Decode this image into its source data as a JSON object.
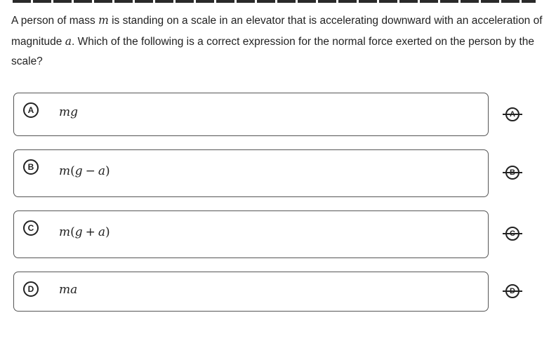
{
  "question": {
    "part1": "A person of mass ",
    "var1": "m",
    "part2": " is standing on a scale in an elevator that is accelerating downward with an acceleration of magnitude ",
    "var2": "a",
    "part3": ". Which of the following is a correct expression for the normal force exerted on the person by the scale?"
  },
  "choices": [
    {
      "letter": "A",
      "expression": "mg"
    },
    {
      "letter": "B",
      "expression": "m(g − a)"
    },
    {
      "letter": "C",
      "expression": "m(g + a)"
    },
    {
      "letter": "D",
      "expression": "ma"
    }
  ]
}
